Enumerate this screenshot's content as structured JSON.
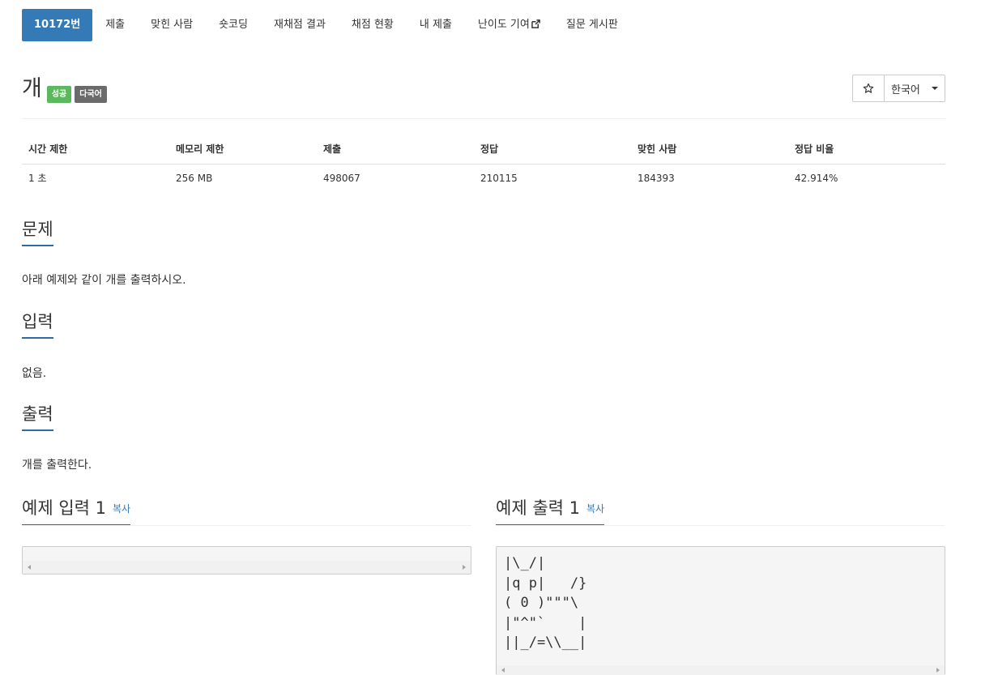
{
  "nav": {
    "items": [
      {
        "label": "10172번",
        "active": true
      },
      {
        "label": "제출"
      },
      {
        "label": "맞힌 사람"
      },
      {
        "label": "숏코딩"
      },
      {
        "label": "재채점 결과"
      },
      {
        "label": "채점 현황"
      },
      {
        "label": "내 제출"
      },
      {
        "label": "난이도 기여",
        "icon": "external-link-icon"
      },
      {
        "label": "질문 게시판"
      }
    ]
  },
  "problem": {
    "title": "개",
    "badges": {
      "success": "성공",
      "multilang": "다국어"
    },
    "star_icon": "star-outline-icon",
    "language": "한국어"
  },
  "info": {
    "headers": [
      "시간 제한",
      "메모리 제한",
      "제출",
      "정답",
      "맞힌 사람",
      "정답 비율"
    ],
    "values": [
      "1 초",
      "256 MB",
      "498067",
      "210115",
      "184393",
      "42.914%"
    ]
  },
  "sections": {
    "problem": {
      "heading": "문제",
      "text": "아래 예제와 같이 개를 출력하시오."
    },
    "input": {
      "heading": "입력",
      "text": "없음."
    },
    "output": {
      "heading": "출력",
      "text": "개를 출력한다."
    }
  },
  "samples": {
    "input": {
      "heading": "예제 입력 1",
      "copy": "복사",
      "content": ""
    },
    "output": {
      "heading": "예제 출력 1",
      "copy": "복사",
      "content": "|\\_/|\n|q p|   /}\n( 0 )\"\"\"\\\n|\"^\"`    |\n||_/=\\\\__|"
    }
  },
  "colors": {
    "primary": "#337ab7",
    "success": "#5cb85c",
    "default": "#6b6b6b"
  }
}
